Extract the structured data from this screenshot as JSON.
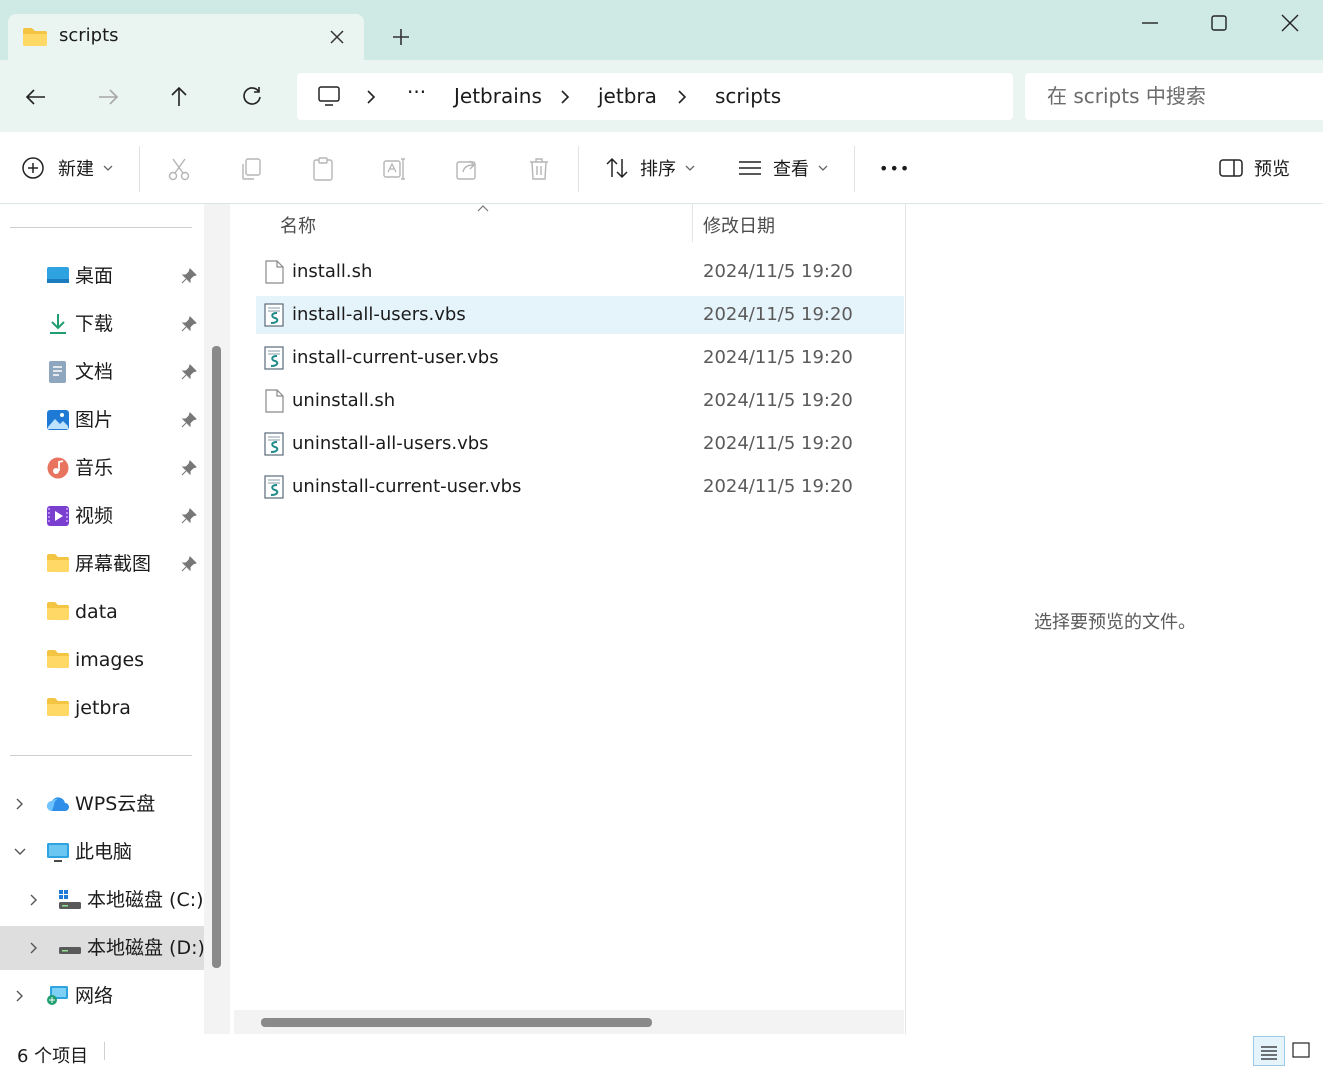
{
  "window": {
    "tab_title": "scripts",
    "new_tab": "+",
    "controls": [
      "minimize-icon",
      "maximize-icon",
      "close-icon"
    ]
  },
  "address_bar": {
    "ellipsis": "···",
    "breadcrumbs": [
      "Jetbrains",
      "jetbra",
      "scripts"
    ],
    "search_placeholder": "在 scripts 中搜索"
  },
  "toolbar": {
    "new_label": "新建",
    "sort_label": "排序",
    "view_label": "查看",
    "more_label": "•••",
    "preview_label": "预览",
    "icons": [
      "cut-icon",
      "copy-icon",
      "paste-icon",
      "rename-icon",
      "share-icon",
      "delete-icon"
    ]
  },
  "sidebar": {
    "quick_access": [
      {
        "label": "桌面",
        "icon": "desktop-icon",
        "pinned": true
      },
      {
        "label": "下载",
        "icon": "download-icon",
        "pinned": true
      },
      {
        "label": "文档",
        "icon": "documents-icon",
        "pinned": true
      },
      {
        "label": "图片",
        "icon": "pictures-icon",
        "pinned": true
      },
      {
        "label": "音乐",
        "icon": "music-icon",
        "pinned": true
      },
      {
        "label": "视频",
        "icon": "videos-icon",
        "pinned": true
      },
      {
        "label": "屏幕截图",
        "icon": "folder-icon",
        "pinned": true
      },
      {
        "label": "data",
        "icon": "folder-icon",
        "pinned": false
      },
      {
        "label": "images",
        "icon": "folder-icon",
        "pinned": false
      },
      {
        "label": "jetbra",
        "icon": "folder-icon",
        "pinned": false
      }
    ],
    "tree": [
      {
        "label": "WPS云盘",
        "icon": "cloud-icon",
        "expanded": false
      },
      {
        "label": "此电脑",
        "icon": "computer-icon",
        "expanded": true
      },
      {
        "label": "本地磁盘 (C:)",
        "icon": "drive-c-icon",
        "expanded": false
      },
      {
        "label": "本地磁盘 (D:)",
        "icon": "drive-d-icon",
        "expanded": false,
        "selected": true
      },
      {
        "label": "网络",
        "icon": "network-icon",
        "expanded": false
      }
    ]
  },
  "file_list": {
    "columns": [
      "名称",
      "修改日期"
    ],
    "files": [
      {
        "name": "install.sh",
        "date": "2024/11/5 19:20",
        "type": "blank"
      },
      {
        "name": "install-all-users.vbs",
        "date": "2024/11/5 19:20",
        "type": "script",
        "hover": true
      },
      {
        "name": "install-current-user.vbs",
        "date": "2024/11/5 19:20",
        "type": "script"
      },
      {
        "name": "uninstall.sh",
        "date": "2024/11/5 19:20",
        "type": "blank"
      },
      {
        "name": "uninstall-all-users.vbs",
        "date": "2024/11/5 19:20",
        "type": "script"
      },
      {
        "name": "uninstall-current-user.vbs",
        "date": "2024/11/5 19:20",
        "type": "script"
      }
    ]
  },
  "preview_pane": {
    "message": "选择要预览的文件。"
  },
  "status_bar": {
    "item_count": "6 个项目"
  },
  "colors": {
    "titlebar": "#cfe9e4",
    "navbar": "#eaf5f1",
    "hover_row": "#e5f3fb",
    "selected_sidebar": "#dedede"
  }
}
